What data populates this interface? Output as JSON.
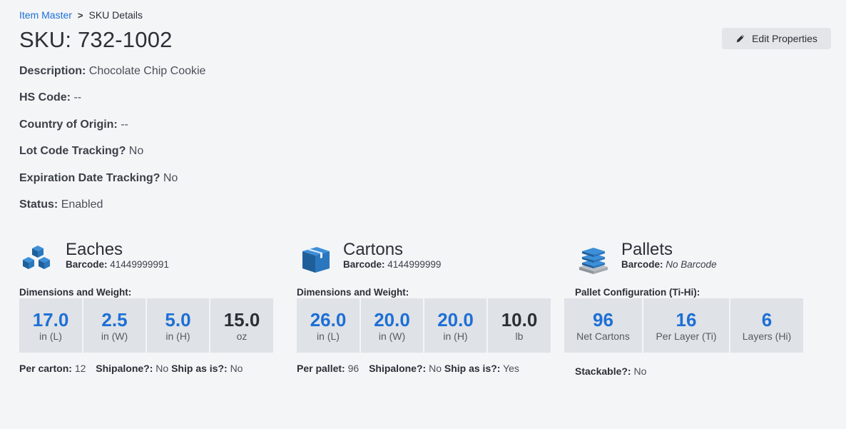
{
  "breadcrumb": {
    "parent": "Item Master",
    "separator": ">",
    "current": "SKU Details"
  },
  "title": "SKU: 732-1002",
  "edit_button": {
    "label": "Edit Properties",
    "icon": "pencil-icon"
  },
  "properties": [
    {
      "label": "Description:",
      "value": "Chocolate Chip Cookie"
    },
    {
      "label": "HS Code:",
      "value": "--"
    },
    {
      "label": "Country of Origin:",
      "value": "--"
    },
    {
      "label": "Lot Code Tracking?",
      "value": "No"
    },
    {
      "label": "Expiration Date Tracking?",
      "value": "No"
    },
    {
      "label": "Status:",
      "value": "Enabled"
    }
  ],
  "eaches": {
    "title": "Eaches",
    "icon": "cubes-icon",
    "barcode_label": "Barcode:",
    "barcode": "41449999991",
    "dims_label": "Dimensions and Weight:",
    "cells": [
      {
        "value": "17.0",
        "unit": "in (L)"
      },
      {
        "value": "2.5",
        "unit": "in (W)"
      },
      {
        "value": "5.0",
        "unit": "in (H)"
      },
      {
        "value": "15.0",
        "unit": "oz"
      }
    ],
    "footer": {
      "per_label": "Per carton:",
      "per_value": "12",
      "shipalone_label": "Shipalone?:",
      "shipalone_value": "No",
      "shipasis_label": "Ship as is?:",
      "shipasis_value": "No"
    }
  },
  "cartons": {
    "title": "Cartons",
    "icon": "box-icon",
    "barcode_label": "Barcode:",
    "barcode": "4144999999",
    "dims_label": "Dimensions and Weight:",
    "cells": [
      {
        "value": "26.0",
        "unit": "in (L)"
      },
      {
        "value": "20.0",
        "unit": "in (W)"
      },
      {
        "value": "20.0",
        "unit": "in (H)"
      },
      {
        "value": "10.0",
        "unit": "lb"
      }
    ],
    "footer": {
      "per_label": "Per pallet:",
      "per_value": "96",
      "shipalone_label": "Shipalone?:",
      "shipalone_value": "No",
      "shipasis_label": "Ship as is?:",
      "shipasis_value": "Yes"
    }
  },
  "pallets": {
    "title": "Pallets",
    "icon": "pallet-icon",
    "barcode_label": "Barcode:",
    "barcode": "No Barcode",
    "config_label": "Pallet Configuration (Ti-Hi):",
    "cells": [
      {
        "value": "96",
        "unit": "Net Cartons"
      },
      {
        "value": "16",
        "unit": "Per Layer (Ti)"
      },
      {
        "value": "6",
        "unit": "Layers (Hi)"
      }
    ],
    "footer": {
      "stackable_label": "Stackable?:",
      "stackable_value": "No"
    }
  },
  "colors": {
    "accent": "#1d6fd6",
    "cell_bg": "#dfe2e6",
    "page_bg": "#f4f5f7"
  }
}
